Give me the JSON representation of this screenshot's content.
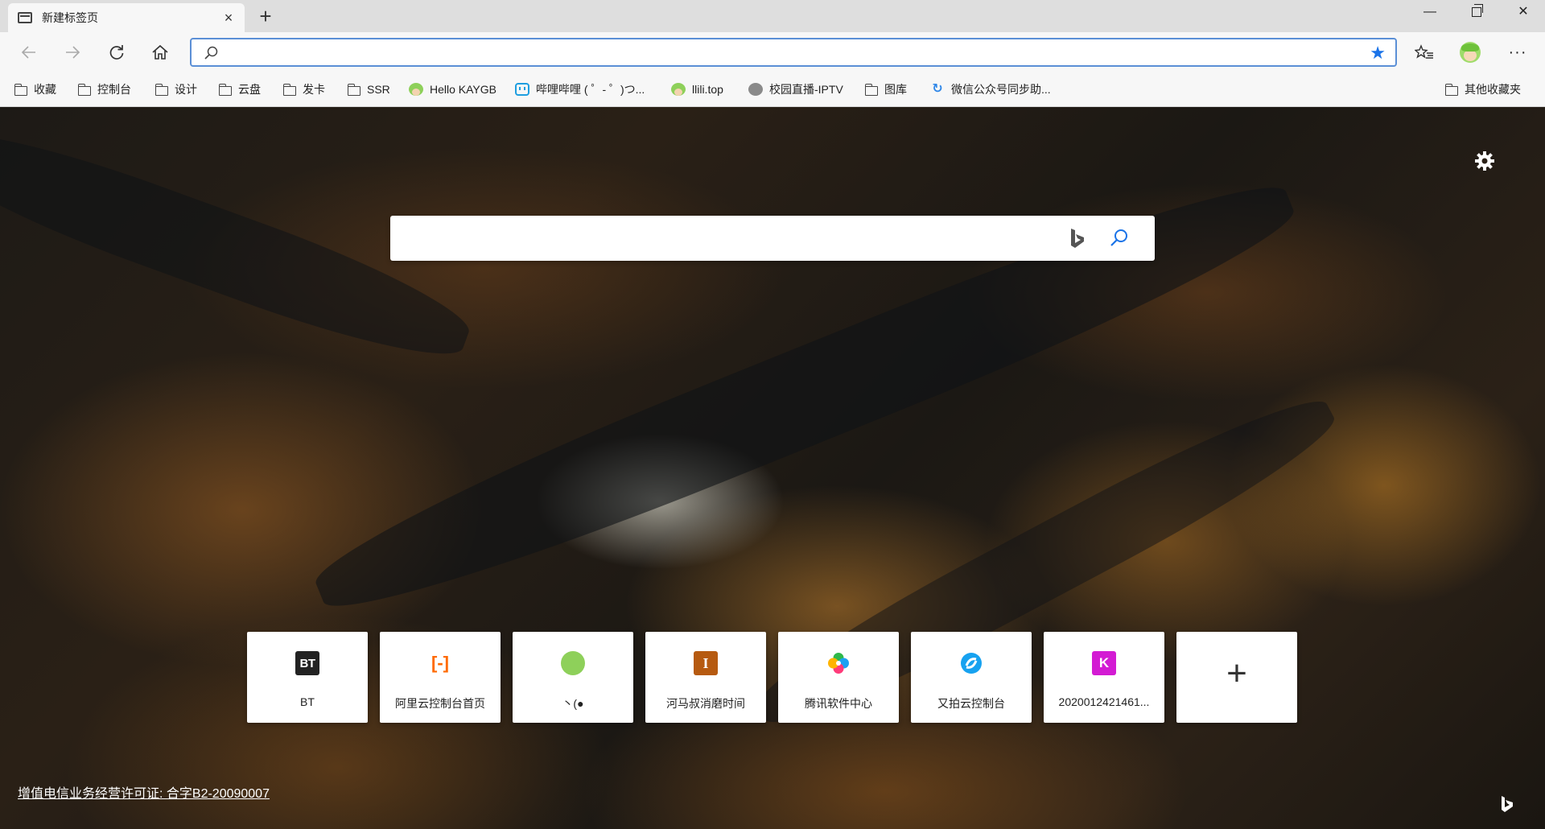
{
  "tab": {
    "title": "新建标签页",
    "close": "×"
  },
  "window": {
    "minimize": "—",
    "close": "✕",
    "new_tab": "+"
  },
  "address_bar": {
    "value": "",
    "placeholder": ""
  },
  "nav": {
    "more": "···"
  },
  "bookmarks": [
    {
      "label": "收藏",
      "icon": "folder-icon"
    },
    {
      "label": "控制台",
      "icon": "folder-icon"
    },
    {
      "label": "设计",
      "icon": "folder-icon"
    },
    {
      "label": "云盘",
      "icon": "folder-icon"
    },
    {
      "label": "发卡",
      "icon": "folder-icon"
    },
    {
      "label": "SSR",
      "icon": "folder-icon"
    },
    {
      "label": "Hello KAYGB",
      "icon": "avatar-icon"
    },
    {
      "label": "哔哩哔哩 ( ゜- ゜)つ...",
      "icon": "bilibili-icon"
    },
    {
      "label": "llili.top",
      "icon": "avatar-icon"
    },
    {
      "label": "校园直播-IPTV",
      "icon": "tv-icon"
    },
    {
      "label": "图库",
      "icon": "folder-icon"
    },
    {
      "label": "微信公众号同步助...",
      "icon": "sync-icon"
    }
  ],
  "other_bookmarks": "其他收藏夹",
  "search": {
    "placeholder": "",
    "value": ""
  },
  "tiles": [
    {
      "label": "BT",
      "icon_text": "BT"
    },
    {
      "label": "阿里云控制台首页",
      "icon_text": "[-]"
    },
    {
      "label": "丶(●",
      "icon_text": ""
    },
    {
      "label": "河马叔消磨时间",
      "icon_text": "I"
    },
    {
      "label": "腾讯软件中心",
      "icon_text": ""
    },
    {
      "label": "又拍云控制台",
      "icon_text": ""
    },
    {
      "label": "2020012421461...",
      "icon_text": "K"
    }
  ],
  "add_tile": "+",
  "license_text": "增值电信业务经营许可证: 合字B2-20090007",
  "colors": {
    "accent": "#1a73e8",
    "omnibox_border": "#5b8fd6"
  }
}
